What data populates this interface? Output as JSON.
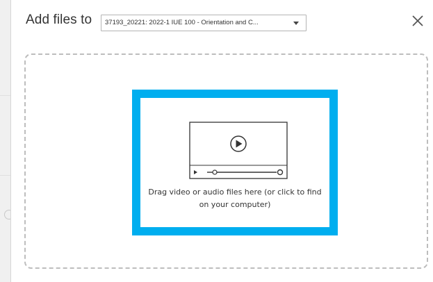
{
  "dialog": {
    "title": "Add files to",
    "folder_select": {
      "value": "37193_20221: 2022-1 IUE 100 - Orientation and C..."
    },
    "close_icon": "close-icon"
  },
  "dropzone": {
    "icon": "video-player-icon",
    "message": "Drag video or audio files here (or click to find on your computer)"
  },
  "colors": {
    "highlight": "#00aeef",
    "dashed_border": "#bdbdbd"
  }
}
